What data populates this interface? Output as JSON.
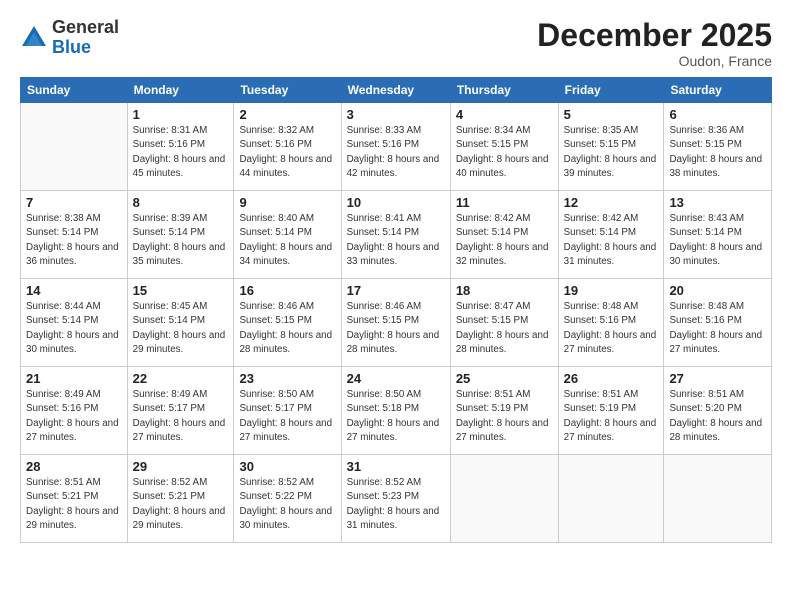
{
  "header": {
    "logo_general": "General",
    "logo_blue": "Blue",
    "month": "December 2025",
    "location": "Oudon, France"
  },
  "weekdays": [
    "Sunday",
    "Monday",
    "Tuesday",
    "Wednesday",
    "Thursday",
    "Friday",
    "Saturday"
  ],
  "weeks": [
    [
      {
        "day": "",
        "info": ""
      },
      {
        "day": "1",
        "info": "Sunrise: 8:31 AM\nSunset: 5:16 PM\nDaylight: 8 hours\nand 45 minutes."
      },
      {
        "day": "2",
        "info": "Sunrise: 8:32 AM\nSunset: 5:16 PM\nDaylight: 8 hours\nand 44 minutes."
      },
      {
        "day": "3",
        "info": "Sunrise: 8:33 AM\nSunset: 5:16 PM\nDaylight: 8 hours\nand 42 minutes."
      },
      {
        "day": "4",
        "info": "Sunrise: 8:34 AM\nSunset: 5:15 PM\nDaylight: 8 hours\nand 40 minutes."
      },
      {
        "day": "5",
        "info": "Sunrise: 8:35 AM\nSunset: 5:15 PM\nDaylight: 8 hours\nand 39 minutes."
      },
      {
        "day": "6",
        "info": "Sunrise: 8:36 AM\nSunset: 5:15 PM\nDaylight: 8 hours\nand 38 minutes."
      }
    ],
    [
      {
        "day": "7",
        "info": "Sunrise: 8:38 AM\nSunset: 5:14 PM\nDaylight: 8 hours\nand 36 minutes."
      },
      {
        "day": "8",
        "info": "Sunrise: 8:39 AM\nSunset: 5:14 PM\nDaylight: 8 hours\nand 35 minutes."
      },
      {
        "day": "9",
        "info": "Sunrise: 8:40 AM\nSunset: 5:14 PM\nDaylight: 8 hours\nand 34 minutes."
      },
      {
        "day": "10",
        "info": "Sunrise: 8:41 AM\nSunset: 5:14 PM\nDaylight: 8 hours\nand 33 minutes."
      },
      {
        "day": "11",
        "info": "Sunrise: 8:42 AM\nSunset: 5:14 PM\nDaylight: 8 hours\nand 32 minutes."
      },
      {
        "day": "12",
        "info": "Sunrise: 8:42 AM\nSunset: 5:14 PM\nDaylight: 8 hours\nand 31 minutes."
      },
      {
        "day": "13",
        "info": "Sunrise: 8:43 AM\nSunset: 5:14 PM\nDaylight: 8 hours\nand 30 minutes."
      }
    ],
    [
      {
        "day": "14",
        "info": "Sunrise: 8:44 AM\nSunset: 5:14 PM\nDaylight: 8 hours\nand 30 minutes."
      },
      {
        "day": "15",
        "info": "Sunrise: 8:45 AM\nSunset: 5:14 PM\nDaylight: 8 hours\nand 29 minutes."
      },
      {
        "day": "16",
        "info": "Sunrise: 8:46 AM\nSunset: 5:15 PM\nDaylight: 8 hours\nand 28 minutes."
      },
      {
        "day": "17",
        "info": "Sunrise: 8:46 AM\nSunset: 5:15 PM\nDaylight: 8 hours\nand 28 minutes."
      },
      {
        "day": "18",
        "info": "Sunrise: 8:47 AM\nSunset: 5:15 PM\nDaylight: 8 hours\nand 28 minutes."
      },
      {
        "day": "19",
        "info": "Sunrise: 8:48 AM\nSunset: 5:16 PM\nDaylight: 8 hours\nand 27 minutes."
      },
      {
        "day": "20",
        "info": "Sunrise: 8:48 AM\nSunset: 5:16 PM\nDaylight: 8 hours\nand 27 minutes."
      }
    ],
    [
      {
        "day": "21",
        "info": "Sunrise: 8:49 AM\nSunset: 5:16 PM\nDaylight: 8 hours\nand 27 minutes."
      },
      {
        "day": "22",
        "info": "Sunrise: 8:49 AM\nSunset: 5:17 PM\nDaylight: 8 hours\nand 27 minutes."
      },
      {
        "day": "23",
        "info": "Sunrise: 8:50 AM\nSunset: 5:17 PM\nDaylight: 8 hours\nand 27 minutes."
      },
      {
        "day": "24",
        "info": "Sunrise: 8:50 AM\nSunset: 5:18 PM\nDaylight: 8 hours\nand 27 minutes."
      },
      {
        "day": "25",
        "info": "Sunrise: 8:51 AM\nSunset: 5:19 PM\nDaylight: 8 hours\nand 27 minutes."
      },
      {
        "day": "26",
        "info": "Sunrise: 8:51 AM\nSunset: 5:19 PM\nDaylight: 8 hours\nand 27 minutes."
      },
      {
        "day": "27",
        "info": "Sunrise: 8:51 AM\nSunset: 5:20 PM\nDaylight: 8 hours\nand 28 minutes."
      }
    ],
    [
      {
        "day": "28",
        "info": "Sunrise: 8:51 AM\nSunset: 5:21 PM\nDaylight: 8 hours\nand 29 minutes."
      },
      {
        "day": "29",
        "info": "Sunrise: 8:52 AM\nSunset: 5:21 PM\nDaylight: 8 hours\nand 29 minutes."
      },
      {
        "day": "30",
        "info": "Sunrise: 8:52 AM\nSunset: 5:22 PM\nDaylight: 8 hours\nand 30 minutes."
      },
      {
        "day": "31",
        "info": "Sunrise: 8:52 AM\nSunset: 5:23 PM\nDaylight: 8 hours\nand 31 minutes."
      },
      {
        "day": "",
        "info": ""
      },
      {
        "day": "",
        "info": ""
      },
      {
        "day": "",
        "info": ""
      }
    ]
  ]
}
